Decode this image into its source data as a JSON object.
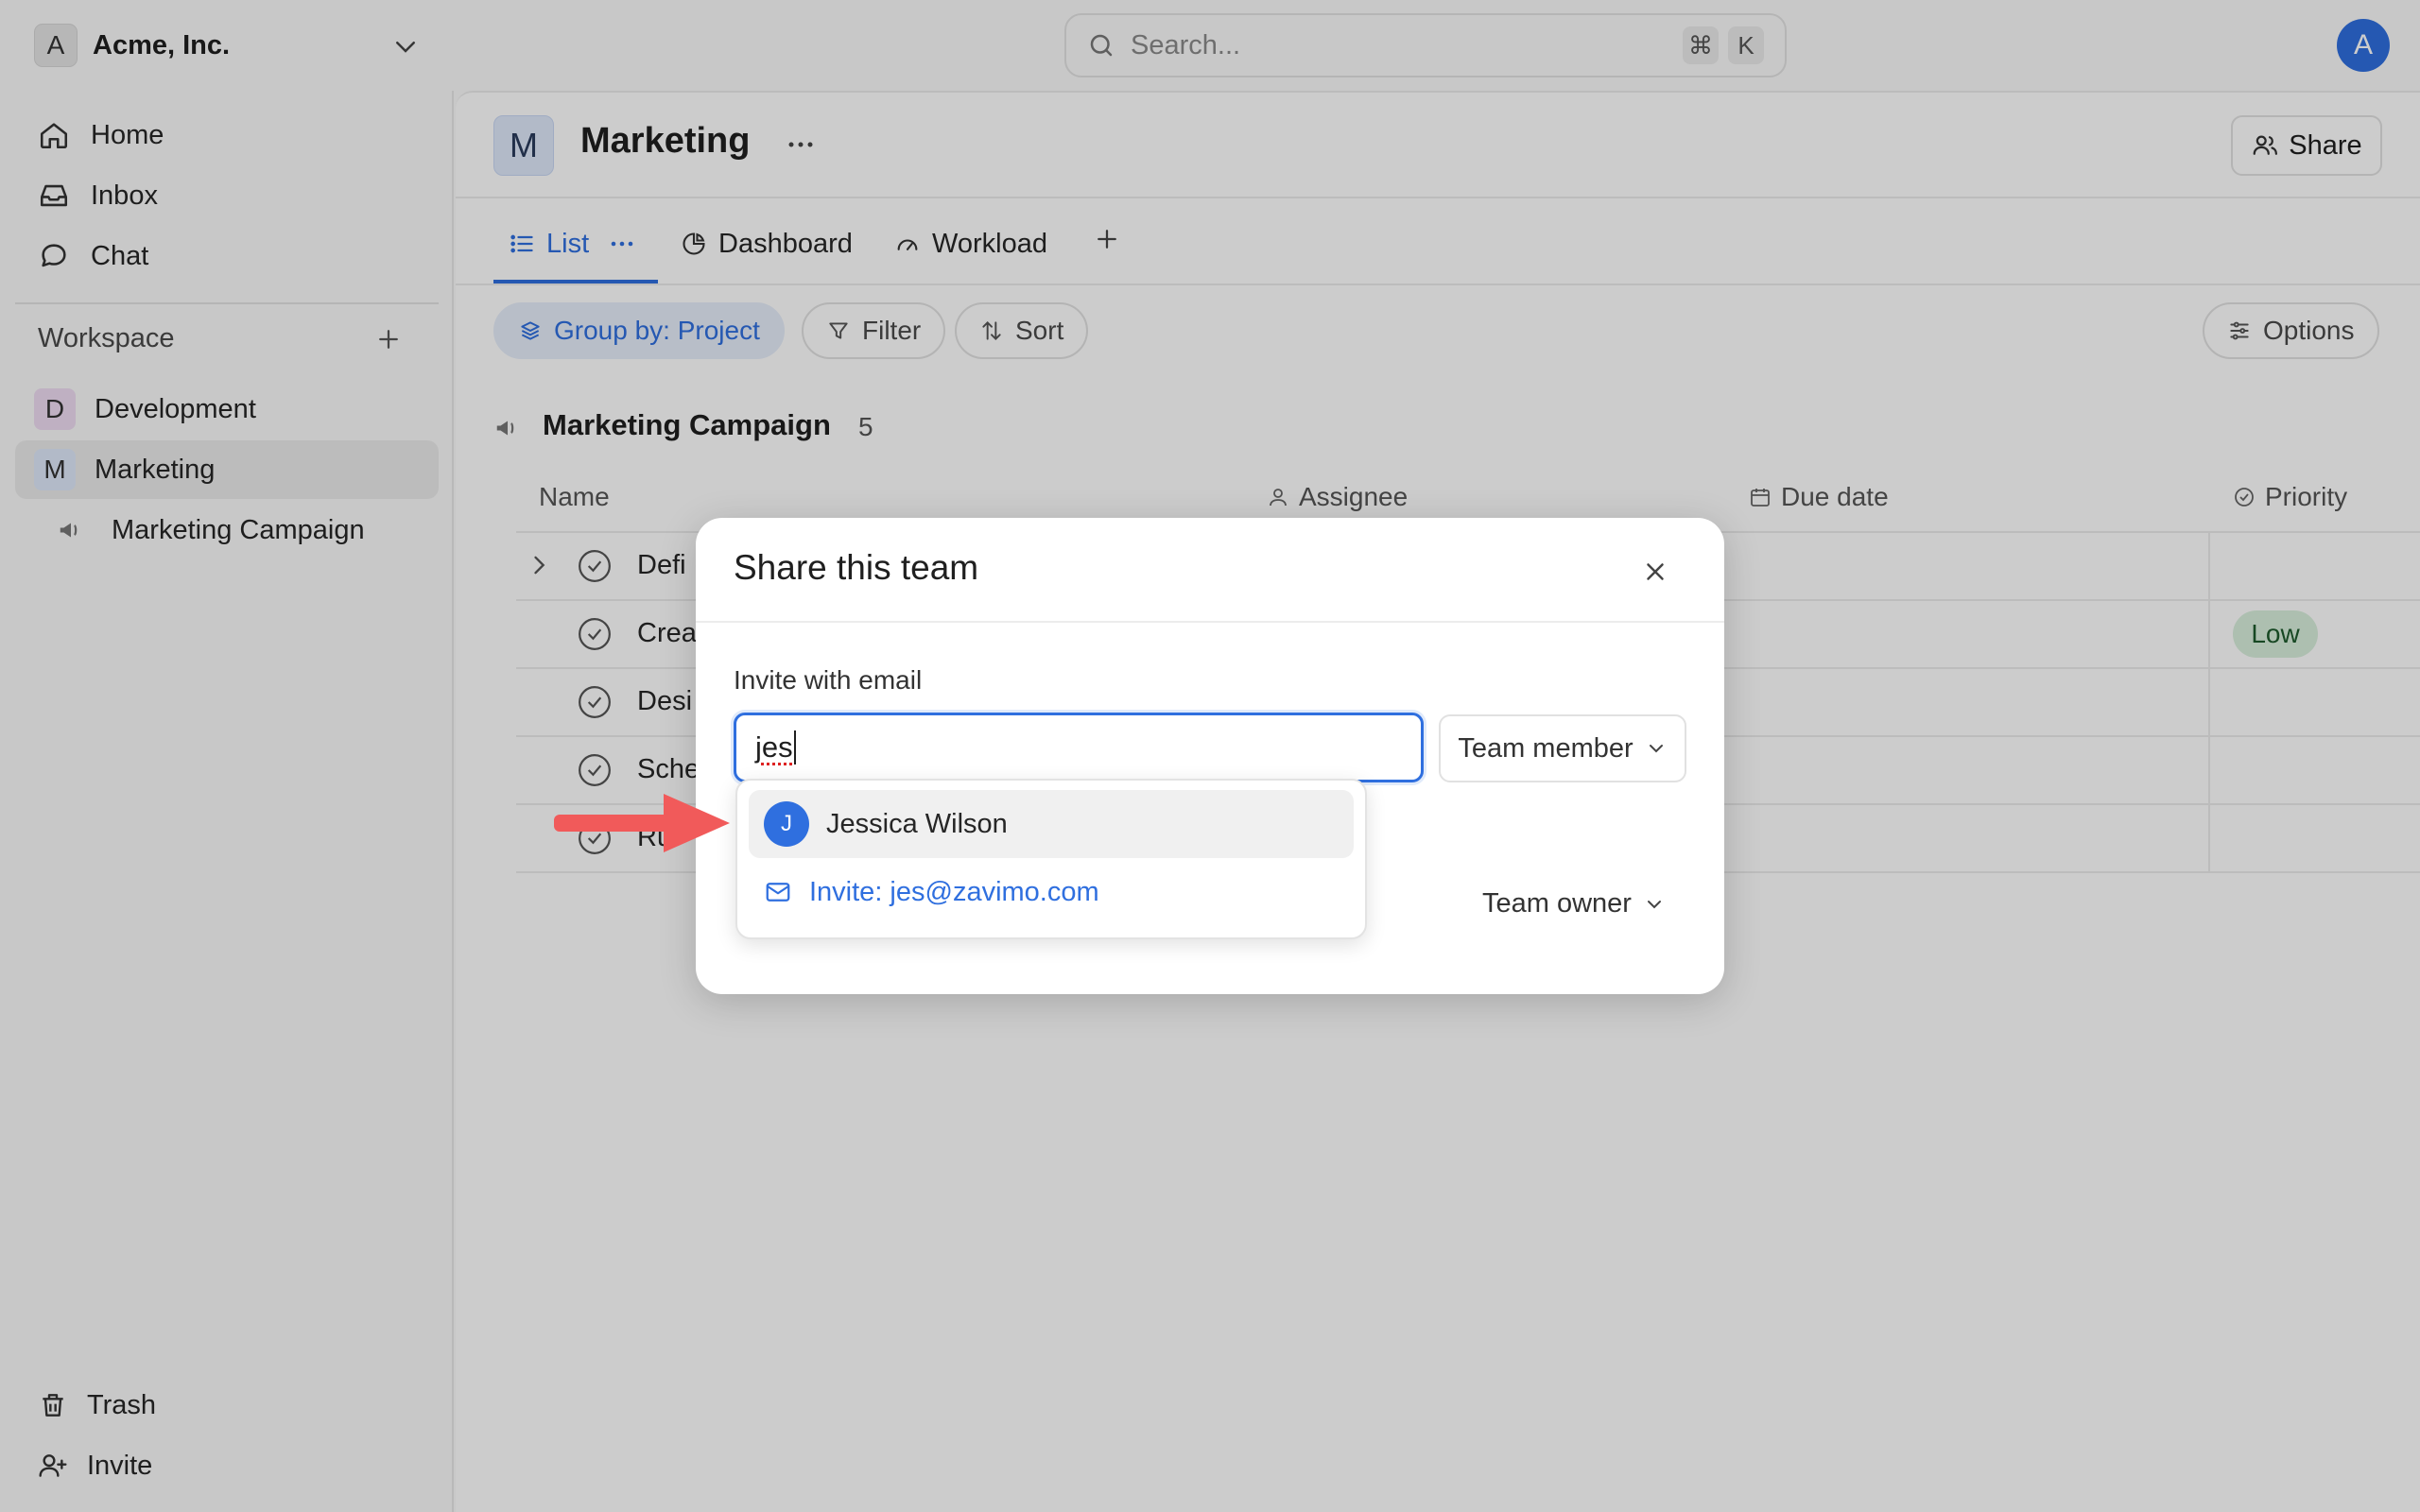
{
  "workspace": {
    "avatar_letter": "A",
    "name": "Acme, Inc."
  },
  "search": {
    "placeholder": "Search...",
    "shortcut_mod": "⌘",
    "shortcut_key": "K"
  },
  "user": {
    "avatar_letter": "A"
  },
  "sidebar": {
    "nav": [
      {
        "label": "Home",
        "icon": "home-icon"
      },
      {
        "label": "Inbox",
        "icon": "inbox-icon"
      },
      {
        "label": "Chat",
        "icon": "chat-icon"
      }
    ],
    "workspace_label": "Workspace",
    "teams": [
      {
        "letter": "D",
        "label": "Development",
        "color": "#efdcf3"
      },
      {
        "letter": "M",
        "label": "Marketing",
        "color": "#dfe9fb"
      }
    ],
    "project": {
      "label": "Marketing Campaign",
      "icon": "megaphone-icon"
    },
    "bottom": [
      {
        "label": "Trash",
        "icon": "trash-icon"
      },
      {
        "label": "Invite",
        "icon": "user-plus-icon"
      }
    ]
  },
  "page": {
    "avatar_letter": "M",
    "title": "Marketing",
    "share_label": "Share",
    "tabs": [
      {
        "label": "List",
        "active": true
      },
      {
        "label": "Dashboard"
      },
      {
        "label": "Workload"
      }
    ],
    "toolbar": {
      "group_by": "Group by: Project",
      "filter": "Filter",
      "sort": "Sort",
      "options": "Options"
    },
    "group": {
      "title": "Marketing Campaign",
      "count": "5"
    },
    "columns": {
      "name": "Name",
      "assignee": "Assignee",
      "due_date": "Due date",
      "priority": "Priority"
    },
    "rows": [
      {
        "name": "Defi",
        "priority": ""
      },
      {
        "name": "Crea",
        "priority": "Low"
      },
      {
        "name": "Desi",
        "priority": ""
      },
      {
        "name": "Sche",
        "priority": ""
      },
      {
        "name": "Ru",
        "priority": ""
      }
    ]
  },
  "modal": {
    "title": "Share this team",
    "invite_label": "Invite with email",
    "input_value": "jes",
    "role": "Team member",
    "owner_role": "Team owner",
    "suggestions": [
      {
        "avatar_letter": "J",
        "name": "Jessica Wilson"
      }
    ],
    "invite_option": "Invite: jes@zavimo.com"
  },
  "colors": {
    "accent": "#2f6fdf",
    "annotation_arrow": "#f15a5a",
    "low_badge": "#d9efdd"
  }
}
